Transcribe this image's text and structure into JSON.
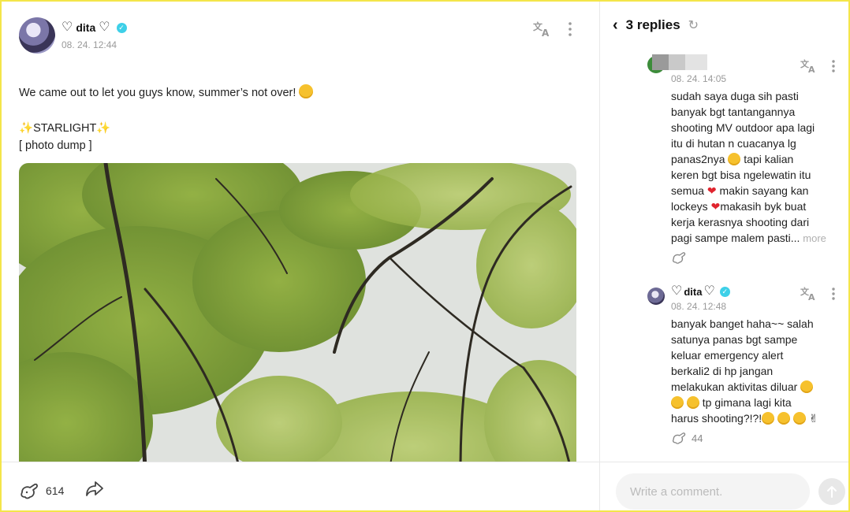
{
  "post": {
    "author": "dita",
    "heart_left": "♡",
    "heart_right": "♡",
    "verified_mark": "✓",
    "time": "08. 24. 12:44",
    "text_line1": "We came out to let you guys know, summer’s not over!",
    "text_line2": "STARLIGHT",
    "text_line3": "[ photo dump ]",
    "likes": "614",
    "icons": {
      "translate": "translate-icon",
      "more": "more-vertical-icon",
      "like": "bunny-like-icon",
      "share": "share-arrow-icon"
    }
  },
  "replies_panel": {
    "title": "3 replies",
    "replies": [
      {
        "time": "08. 24. 14:05",
        "lines": [
          "sudah saya duga sih pasti",
          "banyak bgt tantangannya",
          "shooting MV outdoor apa lagi",
          "itu di hutan n cuacanya lg",
          "panas2nya",
          "tapi kalian",
          "keren bgt bisa ngelewatin itu",
          "semua",
          "makin sayang kan",
          "lockeys",
          "makasih byk buat",
          "kerja kerasnya shooting dari",
          "pagi sampe malem pasti...",
          "more"
        ]
      },
      {
        "author": "dita",
        "time": "08. 24. 12:48",
        "lines": [
          "banyak banget haha~~ salah",
          "satunya panas bgt sampe",
          "keluar emergency alert",
          "berkali2 di hp jangan",
          "melakukan aktivitas diluar",
          "tp gimana lagi kita",
          "harus shooting?!?!"
        ],
        "likes": "44"
      }
    ]
  },
  "comment_box": {
    "placeholder": "Write a comment."
  },
  "colors": {
    "verified": "#3ed0e8",
    "heart": "#e0242e",
    "frame": "#f4e54a"
  }
}
